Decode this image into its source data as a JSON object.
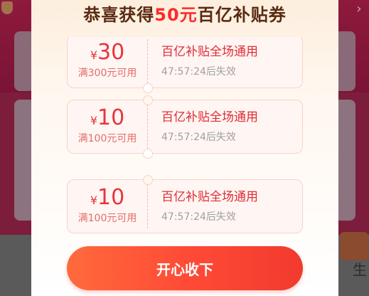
{
  "modal": {
    "title_prefix": "恭喜获得",
    "title_amount": "50元",
    "title_suffix": "百亿补贴券",
    "accept_button": "开心收下"
  },
  "coupons": [
    {
      "symbol": "¥",
      "value": "30",
      "condition": "满300元可用",
      "name": "百亿补贴全场通用",
      "expiry": "47:57:24后失效"
    },
    {
      "symbol": "¥",
      "value": "10",
      "condition": "满100元可用",
      "name": "百亿补贴全场通用",
      "expiry": "47:57:24后失效"
    },
    {
      "symbol": "¥",
      "value": "10",
      "condition": "满100元可用",
      "name": "百亿补贴全场通用",
      "expiry": "47:57:24后失效"
    }
  ],
  "background": {
    "right_edge_char": "生"
  },
  "colors": {
    "accent_red": "#e8343c",
    "button_gradient_start": "#ff6a3c",
    "button_gradient_end": "#f23a2e",
    "title_brown": "#5a2a12"
  }
}
